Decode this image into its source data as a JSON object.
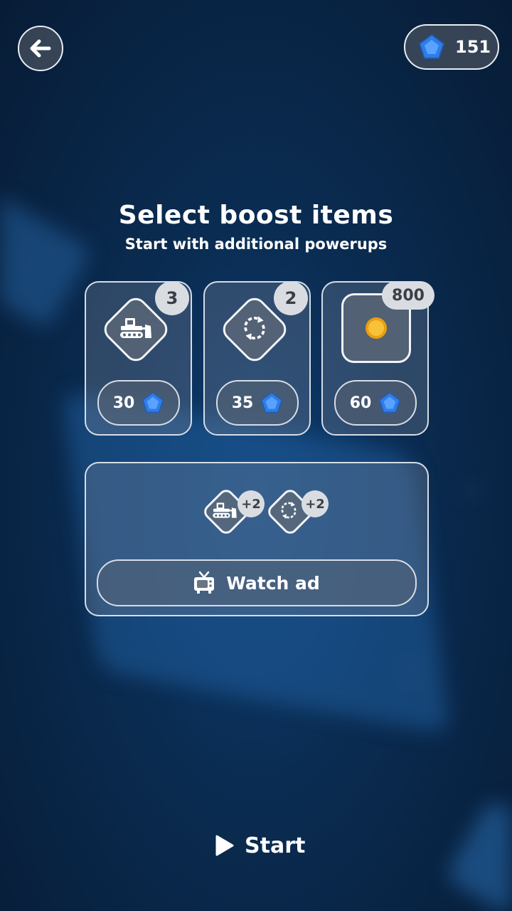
{
  "header": {
    "gems": "151"
  },
  "title": "Select boost items",
  "subtitle": "Start with additional powerups",
  "boosts": [
    {
      "name": "bulldozer",
      "count": "3",
      "price": "30"
    },
    {
      "name": "shuffle",
      "count": "2",
      "price": "35"
    },
    {
      "name": "coin",
      "count": "800",
      "price": "60"
    }
  ],
  "ad_reward": {
    "items": [
      {
        "name": "bulldozer",
        "amount": "+2"
      },
      {
        "name": "shuffle",
        "amount": "+2"
      }
    ],
    "button_label": "Watch ad"
  },
  "start_label": "Start",
  "colors": {
    "gem": "#3a86f0",
    "coin": "#f5b81c",
    "badge": "#d9dde2"
  },
  "icons": [
    "back-arrow-icon",
    "gem-icon",
    "bulldozer-icon",
    "shuffle-icon",
    "coin-icon",
    "tv-icon",
    "play-icon"
  ]
}
